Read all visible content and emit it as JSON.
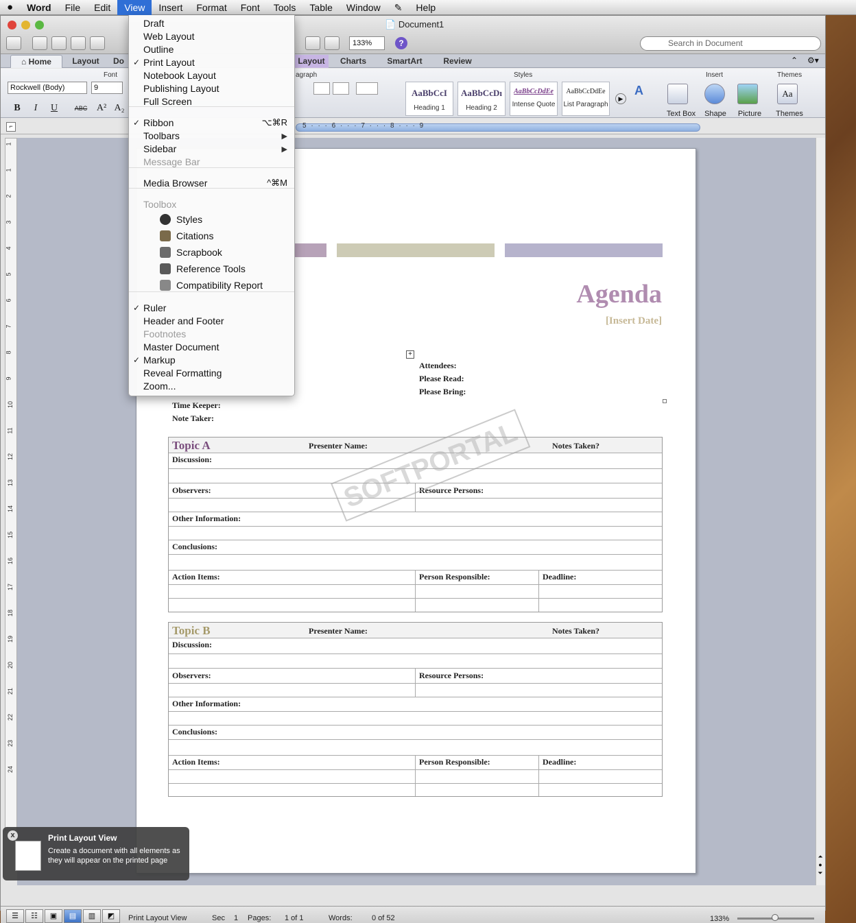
{
  "menubar": {
    "apple": "",
    "app": "Word",
    "items": [
      "File",
      "Edit",
      "View",
      "Insert",
      "Format",
      "Font",
      "Tools",
      "Table",
      "Window",
      "Help"
    ],
    "active": "View"
  },
  "window": {
    "title": "Document1",
    "zoom": "133%",
    "search_placeholder": "Search in Document"
  },
  "ribbon": {
    "tabs": [
      "Home",
      "Layout",
      "Do",
      "Layout",
      "Charts",
      "SmartArt",
      "Review"
    ],
    "font_group": "Font",
    "para_group": "agraph",
    "styles_group": "Styles",
    "insert_group": "Insert",
    "themes_group": "Themes",
    "font_name": "Rockwell (Body)",
    "font_size": "9",
    "format_buttons": [
      "B",
      "I",
      "U",
      "ABC",
      "A²",
      "A₂"
    ],
    "styles": [
      {
        "sample": "AaBbCcI",
        "name": "Heading 1"
      },
      {
        "sample": "AaBbCcDı",
        "name": "Heading 2"
      },
      {
        "sample": "AaBbCcDdEe",
        "name": "Intense Quote"
      },
      {
        "sample": "AaBbCcDdEe",
        "name": "List Paragraph"
      }
    ],
    "insert": [
      "Text Box",
      "Shape",
      "Picture"
    ],
    "themes": "Themes"
  },
  "ruler": {
    "h": "5 · · · 6 · · · 7 · · · 8 · · · 9",
    "v": [
      "1",
      "1",
      "2",
      "3",
      "4",
      "5",
      "6",
      "7",
      "8",
      "9",
      "10",
      "11",
      "12",
      "13",
      "14",
      "15",
      "16",
      "17",
      "18",
      "19",
      "20",
      "21",
      "22",
      "23",
      "24"
    ]
  },
  "view_menu": {
    "items": [
      {
        "label": "Draft"
      },
      {
        "label": "Web Layout"
      },
      {
        "label": "Outline"
      },
      {
        "label": "Print Layout",
        "checked": true
      },
      {
        "label": "Notebook Layout"
      },
      {
        "label": "Publishing Layout"
      },
      {
        "label": "Full Screen"
      },
      {
        "label": "Ribbon",
        "checked": true,
        "shortcut": "⌥⌘R"
      },
      {
        "label": "Toolbars"
      },
      {
        "label": "Sidebar"
      },
      {
        "label": "Message Bar"
      },
      {
        "label": "Media Browser",
        "shortcut": "^⌘M"
      },
      {
        "label": "Toolbox"
      },
      {
        "label": "Styles"
      },
      {
        "label": "Citations"
      },
      {
        "label": "Scrapbook"
      },
      {
        "label": "Reference Tools"
      },
      {
        "label": "Compatibility Report"
      },
      {
        "label": "Ruler",
        "checked": true
      },
      {
        "label": "Header and Footer"
      },
      {
        "label": "Footnotes"
      },
      {
        "label": "Master Document"
      },
      {
        "label": "Markup",
        "checked": true
      },
      {
        "label": "Reveal Formatting"
      },
      {
        "label": "Zoom..."
      }
    ],
    "checkmark": "✓",
    "submenu_arrow": "▶"
  },
  "document": {
    "title": "Agenda",
    "date": "[Insert Date]",
    "right_labels": [
      "Attendees:",
      "Please Read:",
      "Please Bring:"
    ],
    "left_labels": [
      "Time Keeper:",
      "Note Taker:"
    ],
    "topics": [
      {
        "name": "Topic A",
        "presenter": "Presenter Name:",
        "notes": "Notes Taken?"
      },
      {
        "name": "Topic B",
        "presenter": "Presenter Name:",
        "notes": "Notes Taken?"
      }
    ],
    "fields": {
      "discussion": "Discussion:",
      "observers": "Observers:",
      "resource": "Resource Persons:",
      "other": "Other Information:",
      "conclusions": "Conclusions:",
      "action": "Action Items:",
      "person": "Person Responsible:",
      "deadline": "Deadline:"
    },
    "bar_colors": [
      "#b7a2b8",
      "#cdcbb5",
      "#b6b3cc"
    ],
    "watermark": "SOFTPORTAL"
  },
  "tooltip": {
    "title": "Print Layout View",
    "body": "Create a document with all elements as they will appear on the printed page",
    "close": "x"
  },
  "status": {
    "view": "Print Layout View",
    "sec_label": "Sec",
    "sec": "1",
    "pages_label": "Pages:",
    "pages": "1 of 1",
    "words_label": "Words:",
    "words": "0 of 52",
    "zoom": "133%"
  }
}
